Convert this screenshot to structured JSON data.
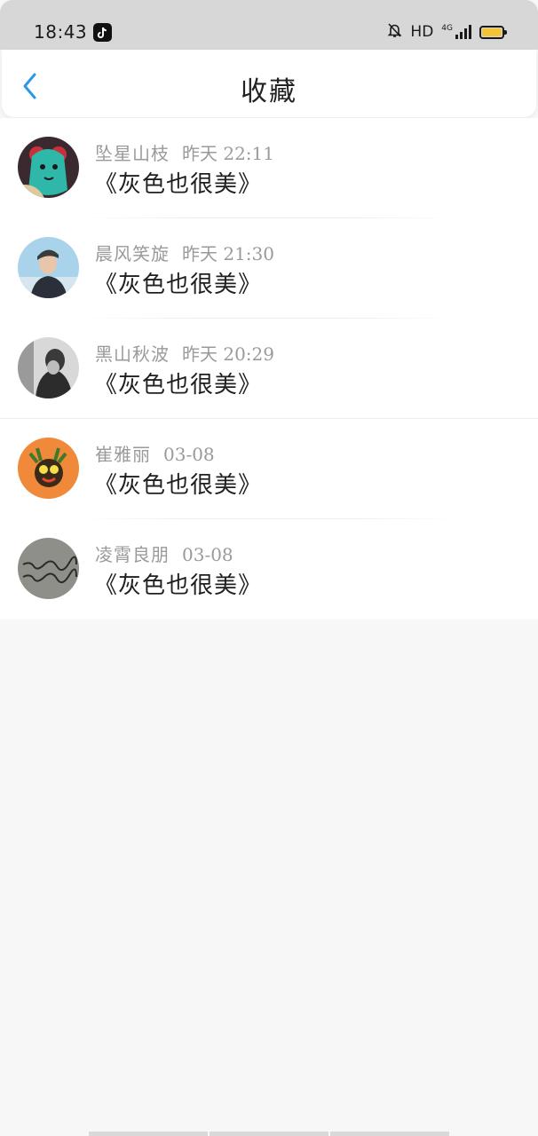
{
  "status_bar": {
    "time": "18:43",
    "app_icon": "tiktok-icon",
    "hd": "HD",
    "network": "4G",
    "icons": [
      "bell-off-icon",
      "signal-icon",
      "battery-icon"
    ],
    "battery_color": "#f3c536"
  },
  "header": {
    "title": "收藏",
    "back_icon": "chevron-left-icon",
    "accent": "#2b9ae6"
  },
  "favorites": [
    {
      "name": "坠星山枝",
      "time": "昨天 22:11",
      "title": "《灰色也很美》"
    },
    {
      "name": "晨风笑旋",
      "time": "昨天 21:30",
      "title": "《灰色也很美》"
    },
    {
      "name": "黑山秋波",
      "time": "昨天 20:29",
      "title": "《灰色也很美》"
    },
    {
      "name": "崔雅丽",
      "time": "03-08",
      "title": "《灰色也很美》"
    },
    {
      "name": "凌霄良朋",
      "time": "03-08",
      "title": "《灰色也很美》"
    }
  ]
}
